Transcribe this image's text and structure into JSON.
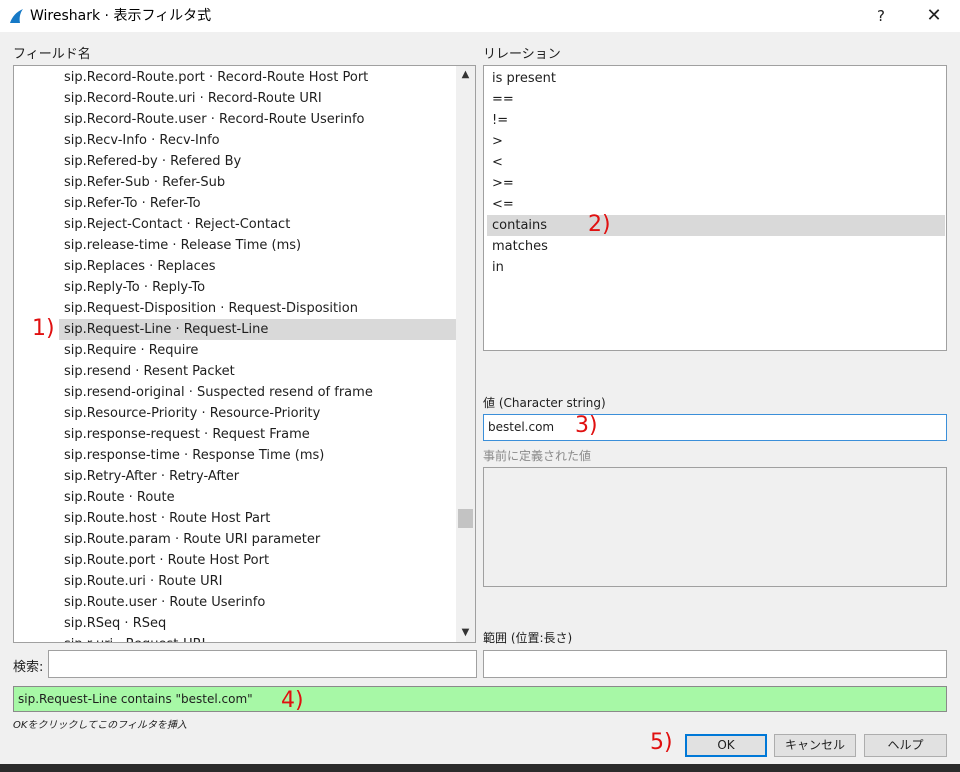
{
  "window": {
    "title": "Wireshark · 表示フィルタ式",
    "help_glyph": "?",
    "close_glyph": "✕"
  },
  "labels": {
    "fields": "フィールド名",
    "relation": "リレーション",
    "value": "値 (Character string)",
    "predefined": "事前に定義された値",
    "range": "範囲 (位置:長さ)",
    "search": "検索:"
  },
  "fields": [
    "sip.Record-Route.port · Record-Route Host Port",
    "sip.Record-Route.uri · Record-Route URI",
    "sip.Record-Route.user · Record-Route Userinfo",
    "sip.Recv-Info · Recv-Info",
    "sip.Refered-by · Refered By",
    "sip.Refer-Sub · Refer-Sub",
    "sip.Refer-To · Refer-To",
    "sip.Reject-Contact · Reject-Contact",
    "sip.release-time · Release Time (ms)",
    "sip.Replaces · Replaces",
    "sip.Reply-To · Reply-To",
    "sip.Request-Disposition · Request-Disposition",
    "sip.Request-Line · Request-Line",
    "sip.Require · Require",
    "sip.resend · Resent Packet",
    "sip.resend-original · Suspected resend of frame",
    "sip.Resource-Priority · Resource-Priority",
    "sip.response-request · Request Frame",
    "sip.response-time · Response Time (ms)",
    "sip.Retry-After · Retry-After",
    "sip.Route · Route",
    "sip.Route.host · Route Host Part",
    "sip.Route.param · Route URI parameter",
    "sip.Route.port · Route Host Port",
    "sip.Route.uri · Route URI",
    "sip.Route.user · Route Userinfo",
    "sip.RSeq · RSeq",
    "sip.r-uri · Request-URI"
  ],
  "selected_field": "sip.Request-Line · Request-Line",
  "relations": [
    "is present",
    "==",
    "!=",
    ">",
    "<",
    ">=",
    "<=",
    "contains",
    "matches",
    "in"
  ],
  "selected_relation": "contains",
  "value_input": "bestel.com",
  "range_input": "",
  "search_input": "",
  "filter_expression": "sip.Request-Line contains \"bestel.com\"",
  "hint": "OKをクリックしてこのフィルタを挿入",
  "buttons": {
    "ok": "OK",
    "cancel": "キャンセル",
    "help": "ヘルプ"
  },
  "annotations": {
    "a1": "1)",
    "a2": "2)",
    "a3": "3)",
    "a4": "4)",
    "a5": "5)"
  },
  "colors": {
    "filter_valid_bg": "#a7f8a6",
    "annotation": "#e01010",
    "selection": "#d9d9d9",
    "focus_border": "#3b8fd9"
  }
}
